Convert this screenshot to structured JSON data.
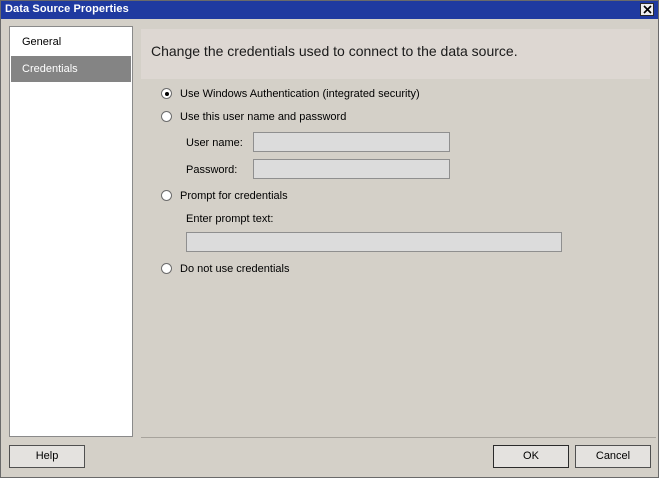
{
  "window": {
    "title": "Data Source Properties",
    "close_icon": "close-icon"
  },
  "sidebar": {
    "items": [
      {
        "label": "General",
        "selected": false
      },
      {
        "label": "Credentials",
        "selected": true
      }
    ]
  },
  "main": {
    "header": "Change the credentials used to connect to the data source.",
    "options": [
      {
        "label": "Use Windows Authentication (integrated security)",
        "selected": true
      },
      {
        "label": "Use this user name and password",
        "selected": false
      },
      {
        "label": "Prompt for credentials",
        "selected": false
      },
      {
        "label": "Do not use credentials",
        "selected": false
      }
    ],
    "username": {
      "label": "User name:",
      "value": ""
    },
    "password": {
      "label": "Password:",
      "value": ""
    },
    "prompt": {
      "label": "Enter prompt text:",
      "value": ""
    }
  },
  "buttons": {
    "help": "Help",
    "ok": "OK",
    "cancel": "Cancel"
  },
  "colors": {
    "titlebar": "#1f3aa0",
    "dialog_bg": "#d4d0c8",
    "selected_nav": "#848484",
    "header_bg": "#ddd7d2"
  }
}
